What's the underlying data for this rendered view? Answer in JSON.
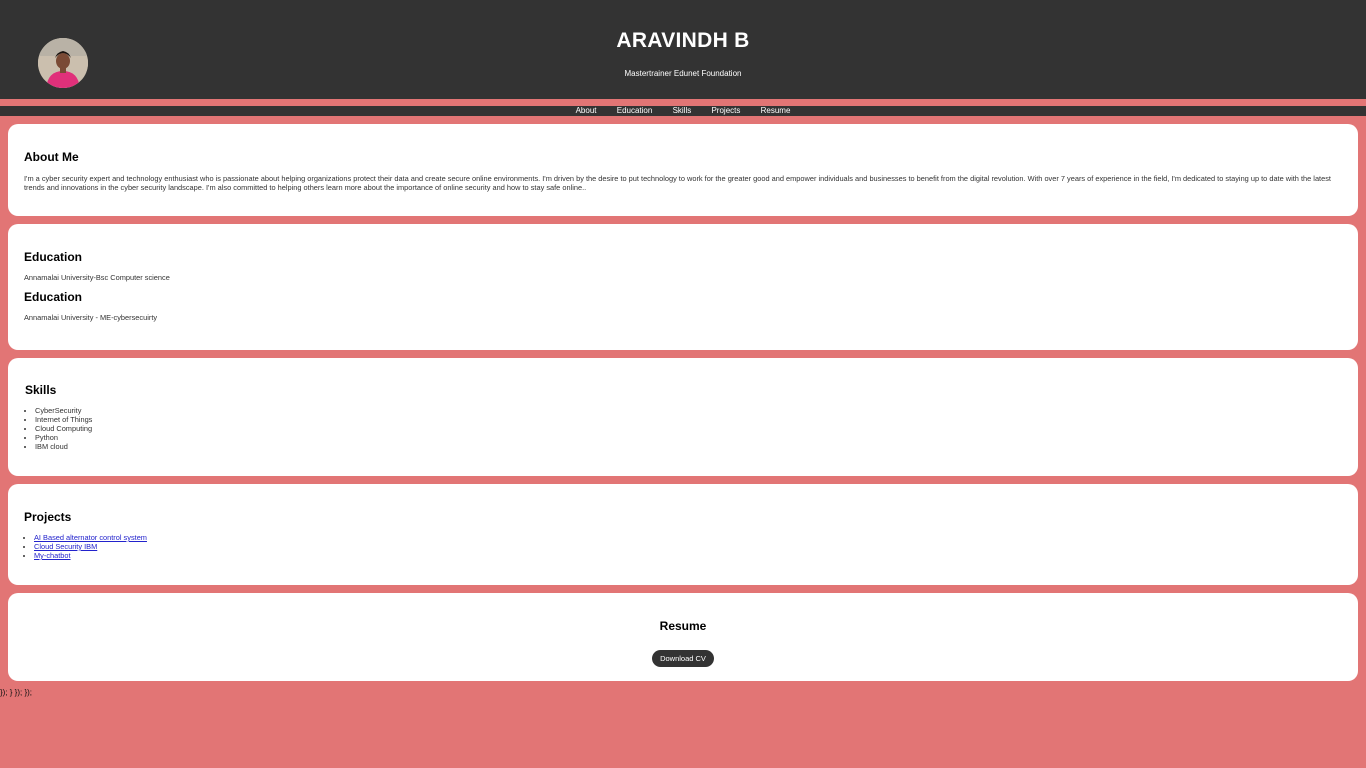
{
  "header": {
    "title": "ARAVINDH B",
    "subtitle": "Mastertrainer Edunet Foundation"
  },
  "nav": {
    "items": [
      "About",
      "Education",
      "Skills",
      "Projects",
      "Resume"
    ]
  },
  "about": {
    "heading": "About Me",
    "text": "I'm a cyber security expert and technology enthusiast who is passionate about helping organizations protect their data and create secure online environments. I'm driven by the desire to put technology to work for the greater good and empower individuals and businesses to benefit from the digital revolution. With over 7 years of experience in the field, I'm dedicated to staying up to date with the latest trends and innovations in the cyber security landscape. I'm also committed to helping others learn more about the importance of online security and how to stay safe online.."
  },
  "education": [
    {
      "heading": "Education",
      "text": "Annamalai University-Bsc Computer science"
    },
    {
      "heading": "Education",
      "text": "Annamalai University - ME-cybersecuirty"
    }
  ],
  "skills": {
    "heading": "Skills",
    "items": [
      "CyberSecurity",
      "Internet of Things",
      "Cloud Computing",
      "Python",
      "IBM cloud"
    ]
  },
  "projects": {
    "heading": "Projects",
    "items": [
      "AI Based alternator control system",
      "Cloud Security IBM",
      "My-chatbot"
    ]
  },
  "resume": {
    "heading": "Resume",
    "button_label": "Download CV"
  },
  "stray_text": "}); } }); });"
}
